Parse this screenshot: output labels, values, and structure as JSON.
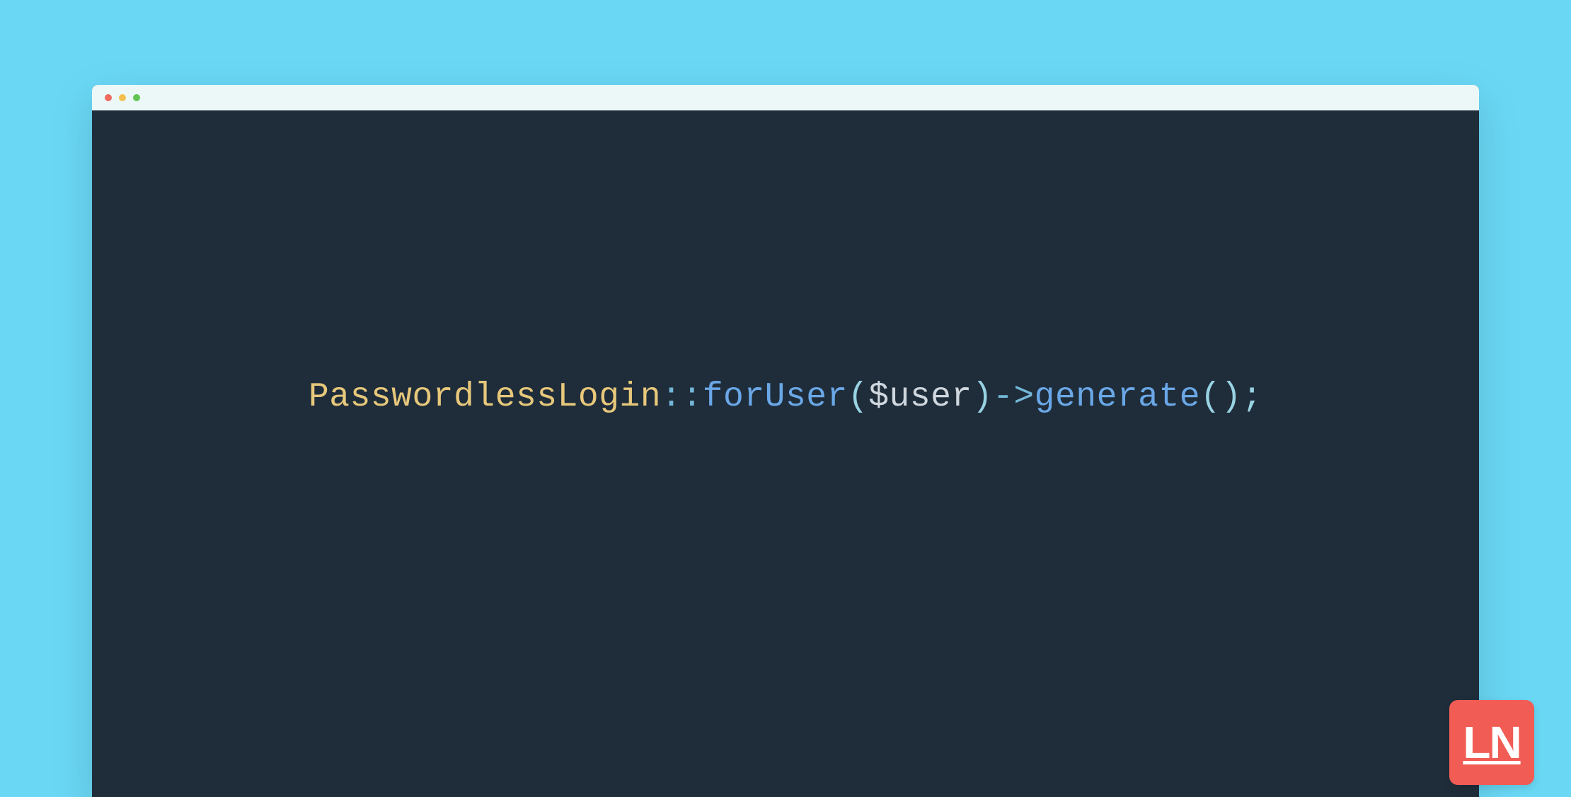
{
  "colors": {
    "background": "#6ad8f5",
    "editor_bg": "#1f2d3a",
    "titlebar_bg": "#ecf8f8",
    "dot_red": "#ee6a5e",
    "dot_yellow": "#f5be4f",
    "dot_green": "#61c554",
    "badge_bg": "#f15c54",
    "token_class": "#e7c87b",
    "token_operator": "#73b8d8",
    "token_function": "#6aa7e6",
    "token_paren": "#98d3e3",
    "token_variable": "#cfd6dd"
  },
  "code": {
    "tokens": {
      "class_name": "PasswordlessLogin",
      "scope_op": "::",
      "method1": "forUser",
      "open_paren1": "(",
      "variable": "$user",
      "close_paren1": ")",
      "arrow": "->",
      "method2": "generate",
      "open_paren2": "(",
      "close_paren2": ")",
      "semicolon": ";"
    },
    "full_line": "PasswordlessLogin::forUser($user)->generate();"
  },
  "badge": {
    "text": "LN"
  }
}
